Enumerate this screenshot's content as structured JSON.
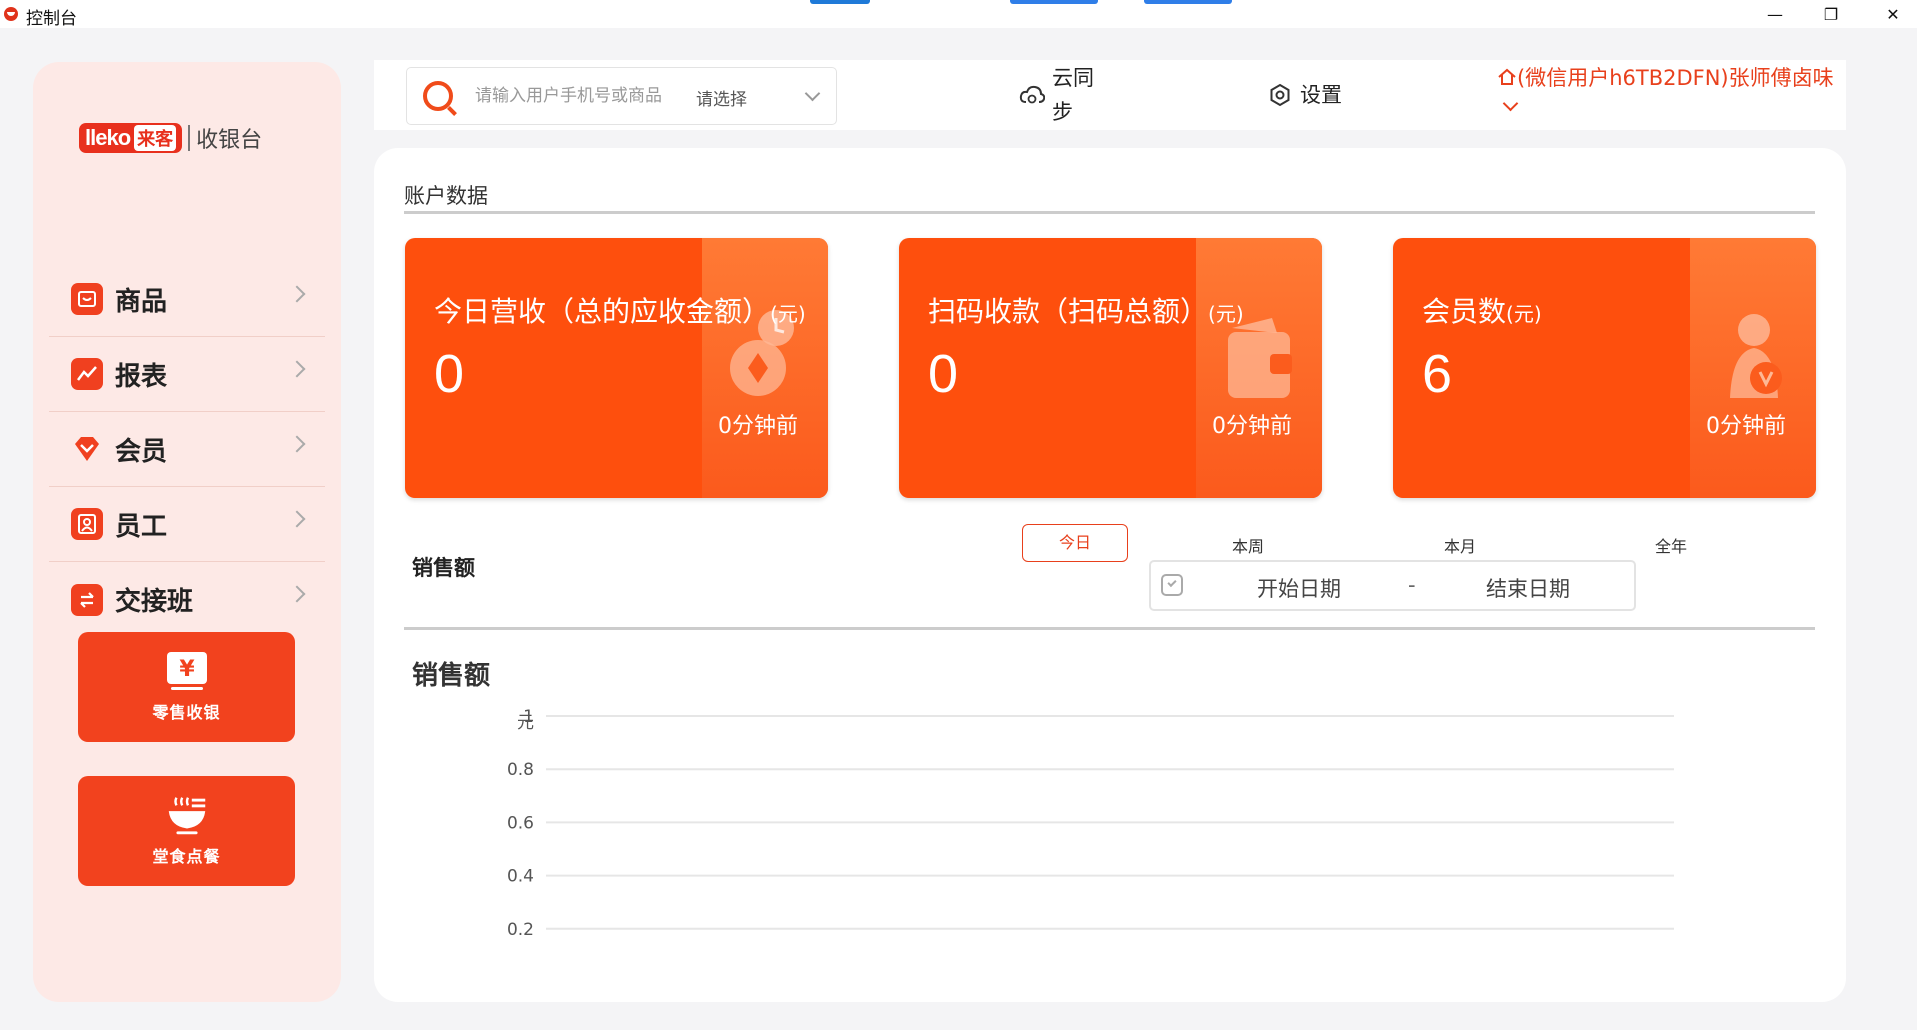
{
  "window": {
    "title": "控制台",
    "controls": {
      "minimize": "—",
      "maximize": "❐",
      "close": "✕"
    }
  },
  "brand": {
    "logo_latin": "lleko",
    "logo_cn": "来客",
    "subtitle": "收银台"
  },
  "sidebar": {
    "items": [
      {
        "label": "商品",
        "icon": "product-icon"
      },
      {
        "label": "报表",
        "icon": "report-icon"
      },
      {
        "label": "会员",
        "icon": "member-icon"
      },
      {
        "label": "员工",
        "icon": "staff-icon"
      },
      {
        "label": "交接班",
        "icon": "shift-handover-icon"
      }
    ],
    "actions": [
      {
        "label": "零售收银",
        "icon": "retail-cashier-icon"
      },
      {
        "label": "堂食点餐",
        "icon": "dine-in-order-icon"
      }
    ]
  },
  "topbar": {
    "search_placeholder": "请输入用户手机号或商品",
    "search_select": "请选择",
    "cloud_sync": "云同步",
    "settings": "设置",
    "user": "(微信用户h6TB2DFN)张师傅卤味"
  },
  "account": {
    "section_title": "账户数据",
    "cards": [
      {
        "label": "今日营收（总的应收金额）",
        "unit": "(元)",
        "value": "0",
        "time": "0分钟前"
      },
      {
        "label": "扫码收款（扫码总额）",
        "unit": "(元)",
        "value": "0",
        "time": "0分钟前"
      },
      {
        "label": "会员数",
        "unit": "(元)",
        "value": "6",
        "time": "0分钟前"
      }
    ]
  },
  "sales": {
    "label": "销售额",
    "ranges": [
      "今日",
      "本周",
      "本月",
      "全年"
    ],
    "active_range": "今日",
    "date_start": "开始日期",
    "date_separator": "-",
    "date_end": "结束日期"
  },
  "chart_data": {
    "type": "line",
    "title": "销售额",
    "ylabel": "元",
    "yticks": [
      "1",
      "0.8",
      "0.6",
      "0.4",
      "0.2"
    ],
    "ylim": [
      0,
      1
    ],
    "series": [],
    "grid": true
  },
  "colors": {
    "accent": "#f2421e",
    "card": "#fe4f0d",
    "sidebar_bg": "#fde9e6",
    "user_text": "#e8401c"
  }
}
